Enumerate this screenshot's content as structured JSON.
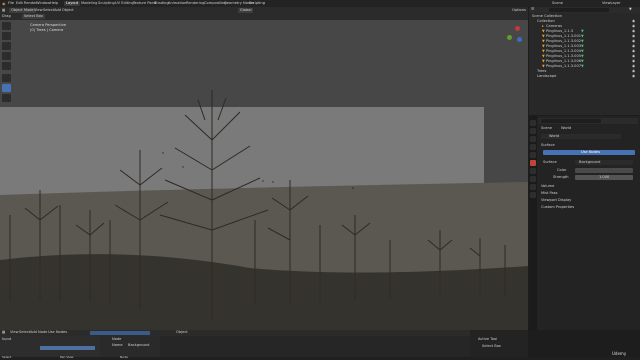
{
  "topbar": {
    "menus": [
      "File",
      "Edit",
      "Render",
      "Window",
      "Help"
    ],
    "workspaces": [
      "Layout",
      "Modeling",
      "Sculpting",
      "UV Editing",
      "Texture Paint",
      "Shading",
      "Animation",
      "Rendering",
      "Compositing",
      "Geometry Nodes",
      "Scripting"
    ],
    "active_workspace": "Layout",
    "scene_label": "Scene",
    "view_layer_label": "ViewLayer"
  },
  "viewport_header": {
    "mode": "Object Mode",
    "menus": [
      "View",
      "Select",
      "Add",
      "Object"
    ],
    "transform": "Global",
    "options": "Options"
  },
  "viewport_subheader": {
    "view": "Drag",
    "select_box": "Select Box"
  },
  "viewport": {
    "overlay_line1": "Camera Perspective",
    "overlay_line2": "(0) Trees | Camera",
    "accent_color": "#4772b3"
  },
  "outliner": {
    "header": "Scene Collection",
    "items": [
      {
        "label": "Scene Collection",
        "depth": 0
      },
      {
        "label": "Collection",
        "depth": 1
      },
      {
        "label": "Cameras",
        "depth": 2
      },
      {
        "label": "Pinglinus_1.1.3",
        "depth": 2
      },
      {
        "label": "Pinglinus_1.1.3.001",
        "depth": 2
      },
      {
        "label": "Pinglinus_1.1.3.002",
        "depth": 2
      },
      {
        "label": "Pinglinus_1.1.3.003",
        "depth": 2
      },
      {
        "label": "Pinglinus_1.1.3.004",
        "depth": 2
      },
      {
        "label": "Pinglinus_1.1.3.005",
        "depth": 2
      },
      {
        "label": "Pinglinus_1.1.3.006",
        "depth": 2
      },
      {
        "label": "Pinglinus_1.1.3.007",
        "depth": 2
      },
      {
        "label": "Trees",
        "depth": 1
      },
      {
        "label": "Landscape",
        "depth": 1
      }
    ]
  },
  "properties": {
    "breadcrumb_scene": "Scene",
    "breadcrumb_world": "World",
    "world_name": "World",
    "section_surface": "Surface",
    "use_nodes": "Use Nodes",
    "surface_label": "Surface",
    "surface_value": "Background",
    "color_label": "Color",
    "strength_label": "Strength",
    "strength_value": "1.000",
    "sections": [
      "Volume",
      "Mist Pass",
      "Viewport Display",
      "Custom Properties"
    ]
  },
  "bottom": {
    "menus": [
      "View",
      "Select",
      "Add",
      "Node",
      "Use Nodes"
    ],
    "editor_type": "Object",
    "active_tool_label": "Active Tool",
    "active_tool_value": "Select Box",
    "node_title": "Node",
    "node_label": "Name",
    "node_value": "Background",
    "node_input": "Input"
  },
  "status": {
    "left": "Select",
    "middle": "Pan View",
    "right": "Node"
  },
  "watermark": "Udemy"
}
